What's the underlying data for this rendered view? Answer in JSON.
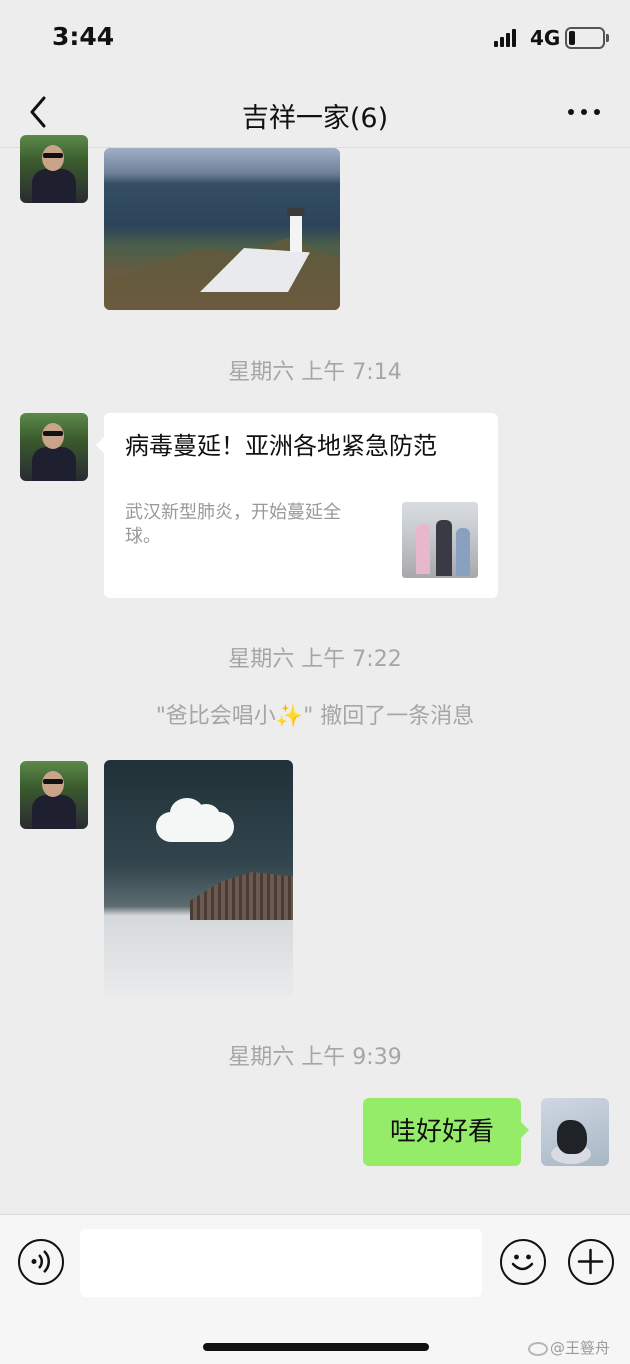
{
  "status_bar": {
    "time": "3:44",
    "network": "4G"
  },
  "header": {
    "title": "吉祥一家(6)",
    "back_icon": "chevron-left-icon",
    "more_icon": "ellipsis-icon"
  },
  "messages": [
    {
      "type": "image",
      "sender": "other",
      "image": "lighthouse-photo"
    },
    {
      "type": "timestamp",
      "text": "星期六 上午 7:14"
    },
    {
      "type": "link",
      "sender": "other",
      "title": "病毒蔓延！亚洲各地紧急防范",
      "description": "武汉新型肺炎，开始蔓延全球。",
      "thumbnail": "crowd-photo"
    },
    {
      "type": "timestamp",
      "text": "星期六 上午 7:22"
    },
    {
      "type": "recall",
      "text": "\"爸比会唱小✨\" 撤回了一条消息"
    },
    {
      "type": "image",
      "sender": "other",
      "image": "cloud-field-photo"
    },
    {
      "type": "timestamp",
      "text": "星期六 上午 9:39"
    },
    {
      "type": "text",
      "sender": "me",
      "text": "哇好好看"
    }
  ],
  "input_bar": {
    "voice_icon": "voice-icon",
    "emoji_icon": "emoji-icon",
    "plus_icon": "plus-icon",
    "input_value": ""
  },
  "watermark": "@王簦舟",
  "colors": {
    "background": "#ededed",
    "my_bubble": "#95ec69",
    "other_bubble": "#ffffff",
    "system_text": "#a6a6a6"
  }
}
